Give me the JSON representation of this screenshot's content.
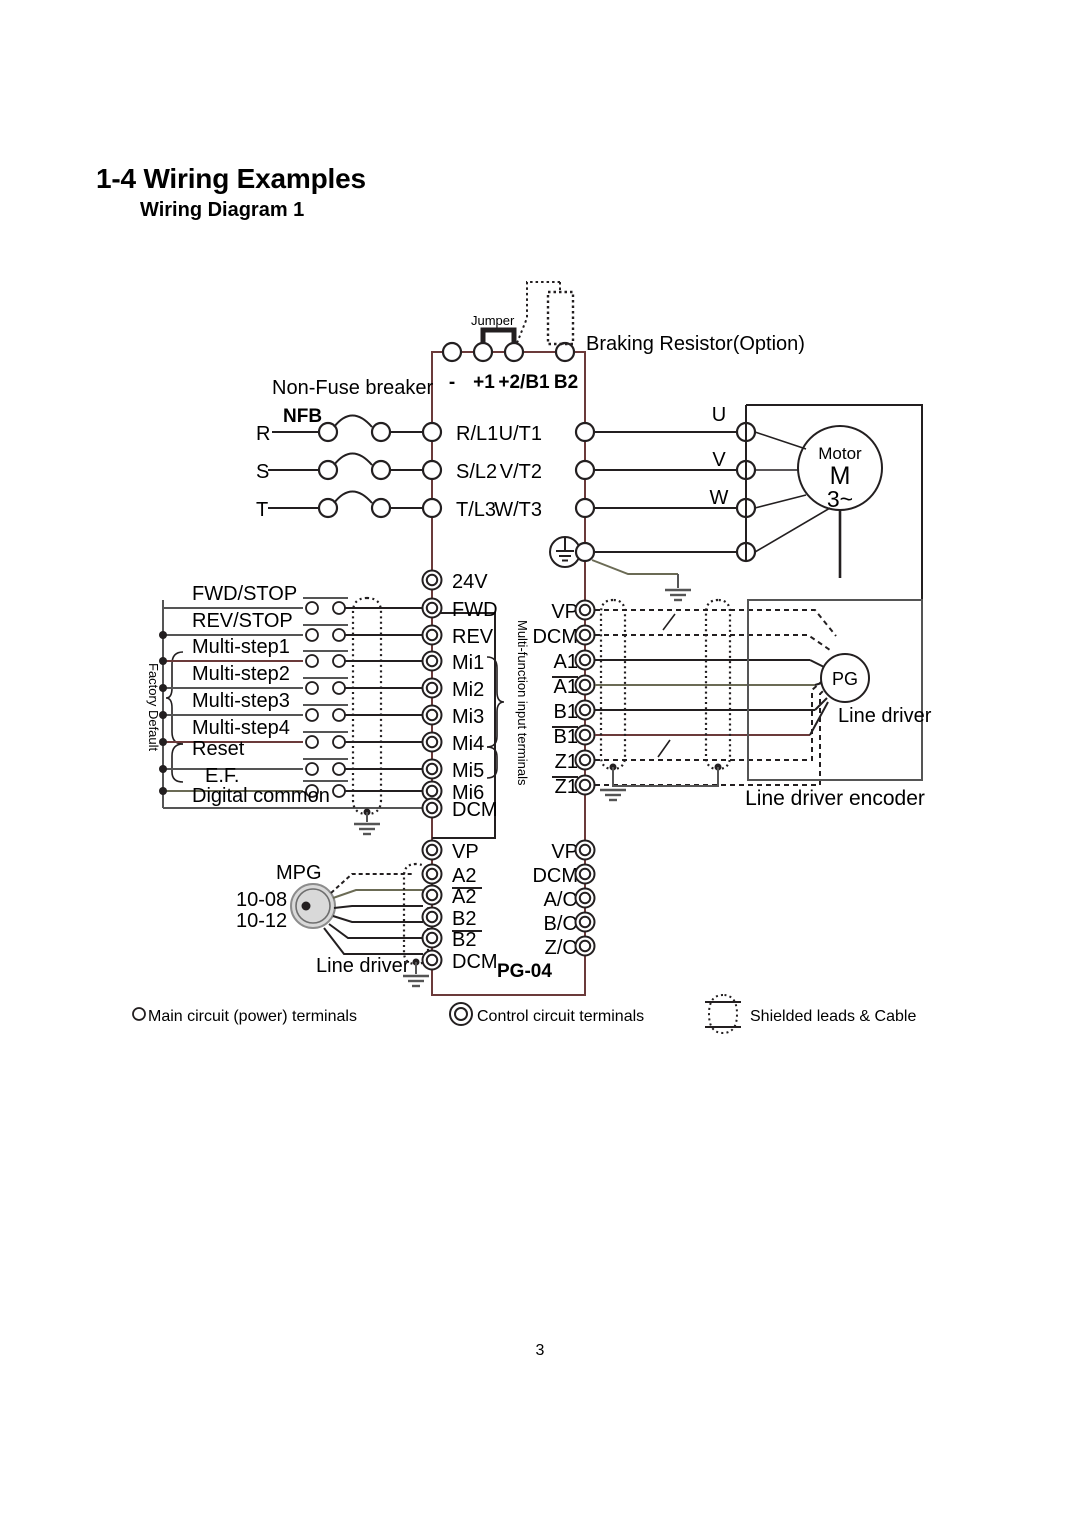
{
  "document": {
    "section_title": "1-4 Wiring Examples",
    "sub_title": "Wiring Diagram 1",
    "page_number": "3"
  },
  "colors": {
    "line": "#231f20",
    "wire_red": "#6b3a3a",
    "fill_gray": "#d9d9d9",
    "background": "#ffffff"
  },
  "diagram": {
    "top": {
      "jumper_label": "Jumper",
      "braking_resistor_label": "Braking Resistor(Option)",
      "dc_bus_terminals": [
        "-",
        "+1",
        "+2/B1",
        "B2"
      ]
    },
    "input_side": {
      "breaker_label": "Non-Fuse breaker",
      "nfb_label": "NFB",
      "supply_phases": [
        "R",
        "S",
        "T"
      ],
      "power_input_terminals": [
        "R/L1",
        "S/L2",
        "T/L3"
      ]
    },
    "output_side": {
      "power_output_terminals": [
        "U/T1",
        "V/T2",
        "W/T3"
      ],
      "ground_symbol": "earth-ground",
      "motor_terminals": [
        "U",
        "V",
        "W"
      ],
      "motor_label": "Motor",
      "motor_symbol": "M",
      "motor_phase": "3~"
    },
    "digital_inputs": {
      "vertical_label_left": "Factory Default",
      "vertical_label_right": "Multi-function input terminals",
      "rows": [
        {
          "function": "",
          "terminal": "24V",
          "has_switch": false
        },
        {
          "function": "FWD/STOP",
          "terminal": "FWD",
          "has_switch": true
        },
        {
          "function": "REV/STOP",
          "terminal": "REV",
          "has_switch": true
        },
        {
          "function": "Multi-step1",
          "terminal": "Mi1",
          "has_switch": true
        },
        {
          "function": "Multi-step2",
          "terminal": "Mi2",
          "has_switch": true
        },
        {
          "function": "Multi-step3",
          "terminal": "Mi3",
          "has_switch": true
        },
        {
          "function": "Multi-step4",
          "terminal": "Mi4",
          "has_switch": true
        },
        {
          "function": "Reset",
          "terminal": "Mi5",
          "has_switch": true
        },
        {
          "function": "E.F.",
          "terminal": "Mi6",
          "has_switch": true
        },
        {
          "function": "Digital common",
          "terminal": "DCM",
          "has_switch": false
        }
      ]
    },
    "pg_card_inputs": {
      "terminals": [
        {
          "label": "VP",
          "overline": false
        },
        {
          "label": "DCM",
          "overline": false
        },
        {
          "label": "A1",
          "overline": false
        },
        {
          "label": "A1",
          "overline": true
        },
        {
          "label": "B1",
          "overline": false
        },
        {
          "label": "B1",
          "overline": true
        },
        {
          "label": "Z1",
          "overline": false
        },
        {
          "label": "Z1",
          "overline": true
        }
      ]
    },
    "encoder": {
      "pg_label": "PG",
      "line_driver_label": "Line driver",
      "box_caption": "Line driver encoder"
    },
    "mpg_section": {
      "mpg_label": "MPG",
      "parameters": [
        "10-08",
        "10-12"
      ],
      "line_driver_label": "Line driver",
      "card_label": "PG-04",
      "terminals": [
        {
          "label": "VP",
          "overline": false
        },
        {
          "label": "A2",
          "overline": false
        },
        {
          "label": "A2",
          "overline": true
        },
        {
          "label": "B2",
          "overline": false
        },
        {
          "label": "B2",
          "overline": true
        },
        {
          "label": "DCM",
          "overline": false
        }
      ]
    },
    "pg_outputs": {
      "terminals": [
        "VP",
        "DCM",
        "A/O",
        "B/O",
        "Z/O"
      ]
    },
    "legend": [
      {
        "symbol": "single-circle",
        "text": "Main circuit (power) terminals"
      },
      {
        "symbol": "double-circle",
        "text": "Control circuit terminals"
      },
      {
        "symbol": "shield-capsule",
        "text": "Shielded leads & Cable"
      }
    ]
  }
}
